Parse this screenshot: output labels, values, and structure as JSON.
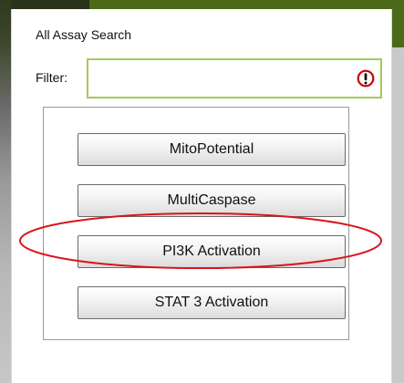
{
  "dialog": {
    "title": "All Assay Search"
  },
  "filter": {
    "label": "Filter:",
    "value": "",
    "placeholder": "",
    "alert_icon": "alert-exclamation-icon",
    "alert_color": "#cc0000",
    "border_color": "#a6c85a"
  },
  "assays": [
    {
      "label": "MitoPotential"
    },
    {
      "label": "MultiCaspase"
    },
    {
      "label": "PI3K Activation",
      "highlighted": true
    },
    {
      "label": "STAT 3 Activation"
    }
  ],
  "annotation": {
    "highlight_color": "#d9141a",
    "highlighted_item": "PI3K Activation"
  },
  "colors": {
    "header_green": "#4a6a1a",
    "header_dark": "#27331b"
  }
}
